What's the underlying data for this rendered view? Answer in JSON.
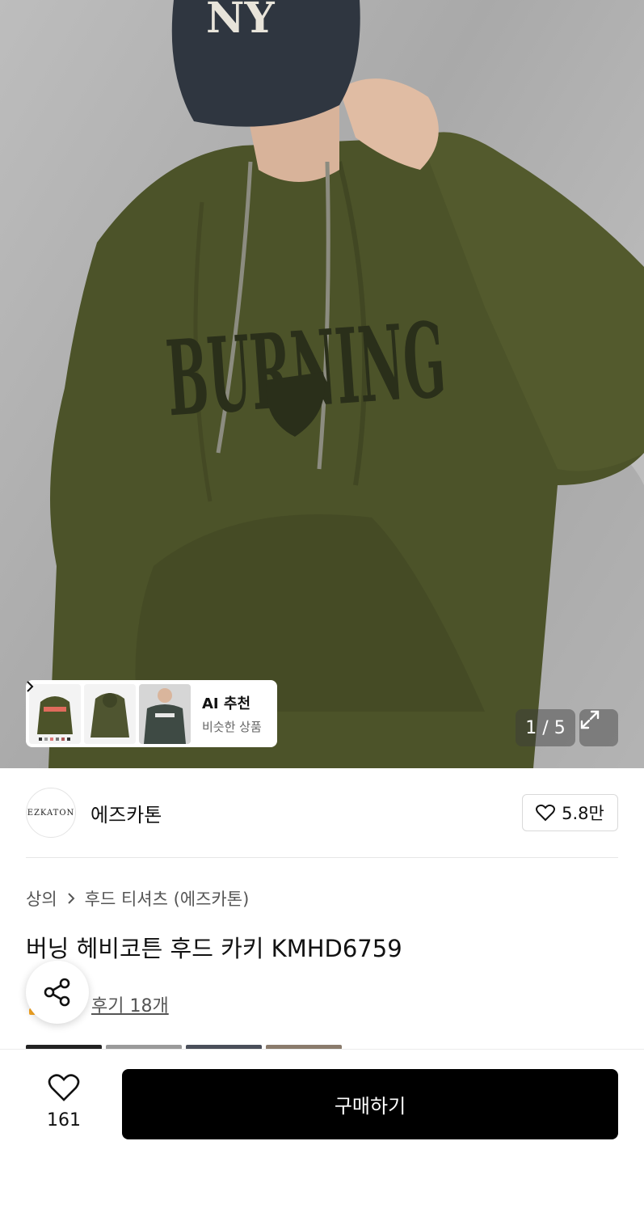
{
  "gallery": {
    "counter": "1 / 5",
    "ai_title": "AI 추천",
    "ai_subtitle": "비슷한 상품",
    "print_text": "BURNING",
    "cap_text": "NY"
  },
  "brand": {
    "logo_text": "EZKATON",
    "name": "에즈카톤",
    "likes": "5.8만"
  },
  "breadcrumb": {
    "level1": "상의",
    "level2": "후드 티셔츠 (에즈카톤)"
  },
  "product": {
    "title": "버닝 헤비코튼 후드 카키 KMHD6759",
    "review_link": "후기 18개"
  },
  "bottom_bar": {
    "wish_count": "161",
    "buy_label": "구매하기"
  },
  "colors": {
    "hoodie": "#4c5329",
    "accent_star": "#f6a623",
    "buy_button": "#000000"
  }
}
